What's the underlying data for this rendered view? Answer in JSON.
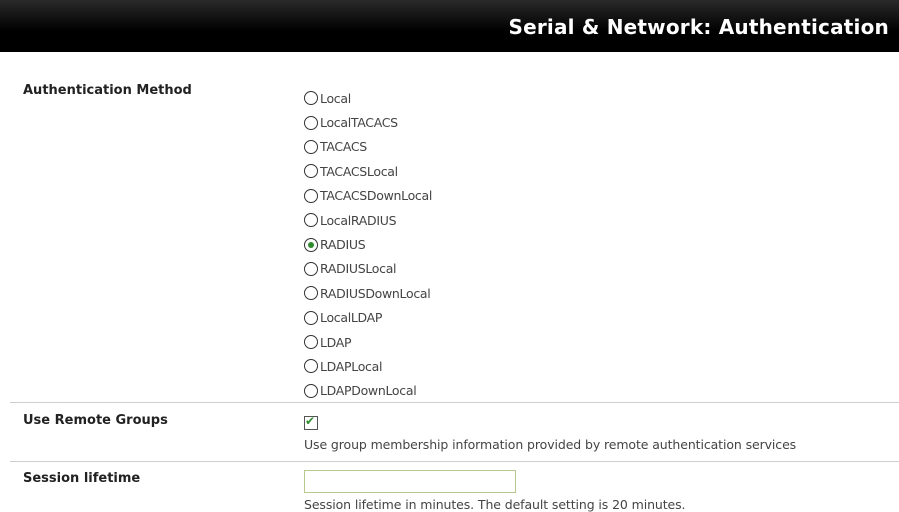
{
  "header": {
    "title": "Serial & Network: Authentication"
  },
  "auth_method": {
    "label": "Authentication Method",
    "options": [
      {
        "label": "Local",
        "checked": false
      },
      {
        "label": "LocalTACACS",
        "checked": false
      },
      {
        "label": "TACACS",
        "checked": false
      },
      {
        "label": "TACACSLocal",
        "checked": false
      },
      {
        "label": "TACACSDownLocal",
        "checked": false
      },
      {
        "label": "LocalRADIUS",
        "checked": false
      },
      {
        "label": "RADIUS",
        "checked": true
      },
      {
        "label": "RADIUSLocal",
        "checked": false
      },
      {
        "label": "RADIUSDownLocal",
        "checked": false
      },
      {
        "label": "LocalLDAP",
        "checked": false
      },
      {
        "label": "LDAP",
        "checked": false
      },
      {
        "label": "LDAPLocal",
        "checked": false
      },
      {
        "label": "LDAPDownLocal",
        "checked": false
      }
    ]
  },
  "remote_groups": {
    "label": "Use Remote Groups",
    "checked": true,
    "help": "Use group membership information provided by remote authentication services"
  },
  "session_lifetime": {
    "label": "Session lifetime",
    "value": "",
    "help": "Session lifetime in minutes. The default setting is 20 minutes."
  },
  "colors": {
    "header_bg": "#000000",
    "check_color": "#2e8b2e",
    "input_border": "#b7c98f"
  }
}
